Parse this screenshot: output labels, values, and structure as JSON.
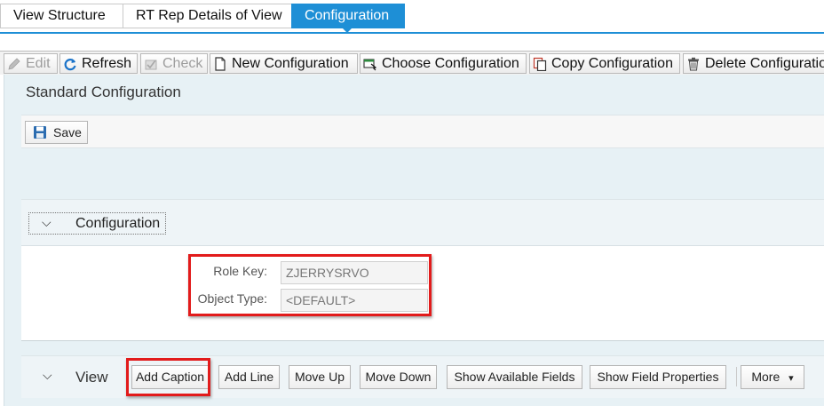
{
  "tabs": [
    {
      "label": "View Structure",
      "active": false
    },
    {
      "label": "RT Rep Details of View",
      "active": false
    },
    {
      "label": "Configuration",
      "active": true
    }
  ],
  "toolbar": {
    "edit": "Edit",
    "refresh": "Refresh",
    "check": "Check",
    "new_configuration": "New Configuration",
    "choose_configuration": "Choose Configuration",
    "copy_configuration": "Copy Configuration",
    "delete_configuration": "Delete Configuratio"
  },
  "panel": {
    "title": "Standard Configuration",
    "save_label": "Save"
  },
  "configuration": {
    "section_label": "Configuration",
    "role_key_label": "Role Key:",
    "role_key_value": "ZJERRYSRVO",
    "object_type_label": "Object Type:",
    "object_type_value": "<DEFAULT>"
  },
  "view": {
    "section_label": "View",
    "buttons": {
      "add_caption": "Add Caption",
      "add_line": "Add Line",
      "move_up": "Move Up",
      "move_down": "Move Down",
      "show_available_fields": "Show Available Fields",
      "show_field_properties": "Show Field Properties",
      "more": "More"
    }
  },
  "colors": {
    "accent": "#1e8fd6",
    "highlight": "#e21b1b",
    "panel_bg": "#e7f1f5"
  },
  "icons": {
    "edit": "pencil-icon",
    "refresh": "refresh-icon",
    "check": "check-icon",
    "new": "new-document-icon",
    "choose": "choose-icon",
    "copy": "copy-icon",
    "delete": "trash-icon",
    "save": "floppy-disk-icon"
  }
}
